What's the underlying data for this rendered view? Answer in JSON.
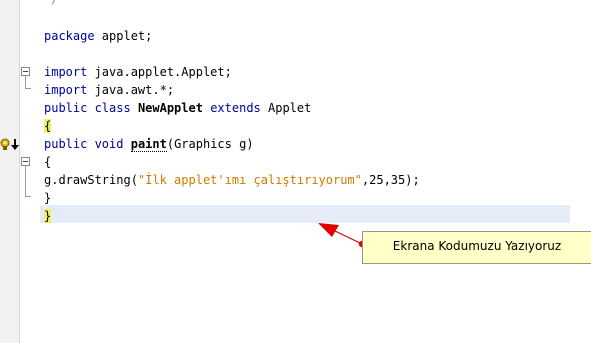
{
  "editor": {
    "top_partial": "*/",
    "lines": {
      "package": {
        "kw": "package",
        "rest": " applet;"
      },
      "import1": {
        "kw": "import",
        "rest": " java.applet.Applet;"
      },
      "import2": {
        "kw": "import",
        "rest": " java.awt.*;"
      },
      "class_decl": {
        "kw1": "public class",
        "name": "NewApplet",
        "kw2": "extends",
        "rest": " Applet"
      },
      "open_brace1": "{",
      "paint_decl": {
        "kw": "public void",
        "name": "paint",
        "rest": "(Graphics g)"
      },
      "open_brace2": "{",
      "draw_call": {
        "pre": "g.drawString(",
        "str": "\"İlk applet'ımı çalıştırıyorum\"",
        "post": ",25,35);"
      },
      "close_brace2": "}",
      "close_brace1": "}"
    }
  },
  "annotation": {
    "text": "Ekrana Kodumuzu Yazıyoruz"
  },
  "icons": {
    "override": "override-method-icon",
    "fold": "fold-collapse-icon"
  },
  "colors": {
    "keyword": "#000099",
    "string": "#ce7b00",
    "brace_highlight": "#f0f066",
    "current_line": "#e6ecf7",
    "callout_bg": "#ffffc8",
    "arrow": "#e00000"
  }
}
